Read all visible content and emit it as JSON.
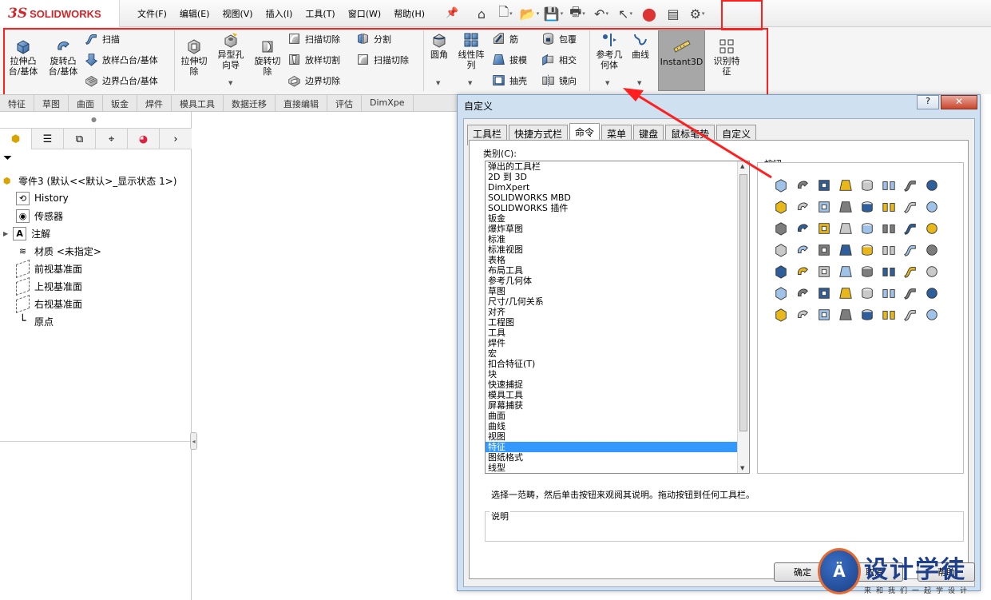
{
  "app": {
    "logo_ds": "3S",
    "logo_name": "SOLIDWORKS"
  },
  "menu": [
    "文件(F)",
    "编辑(E)",
    "视图(V)",
    "插入(I)",
    "工具(T)",
    "窗口(W)",
    "帮助(H)"
  ],
  "quick_tools": [
    "home-icon",
    "new-document-icon",
    "open-icon",
    "save-icon",
    "print-icon",
    "undo-icon",
    "select-icon",
    "rebuild-icon",
    "file-properties-icon",
    "options-gear-icon"
  ],
  "ribbon": {
    "extrude_boss": "拉伸凸\n台/基体",
    "revolve_boss": "旋转凸\n台/基体",
    "sweep": "扫描",
    "loft": "放样凸台/基体",
    "boundary": "边界凸台/基体",
    "extrude_cut": "拉伸切\n除",
    "hole_wizard": "异型孔\n向导",
    "revolve_cut": "旋转切\n除",
    "swept_cut": "扫描切除",
    "lofted_cut": "放样切割",
    "boundary_cut": "边界切除",
    "split": "分割",
    "sweep_cut2": "扫描切除",
    "fillet": "圆角",
    "linear_pattern": "线性阵\n列",
    "rib": "筋",
    "draft": "拔模",
    "shell": "抽壳",
    "wrap": "包覆",
    "intersect": "相交",
    "mirror": "镜向",
    "reference_geometry": "参考几\n何体",
    "curves": "曲线",
    "instant3d": "Instant3D",
    "feature_recognition": "识别特\n征"
  },
  "command_tabs": [
    "特征",
    "草图",
    "曲面",
    "钣金",
    "焊件",
    "模具工具",
    "数据迁移",
    "直接编辑",
    "评估",
    "DimXpe"
  ],
  "feature_manager": {
    "part_name": "零件3 (默认<<默认>_显示状态 1>)",
    "items": [
      {
        "label": "History",
        "icon": "history-icon"
      },
      {
        "label": "传感器",
        "icon": "sensor-icon"
      },
      {
        "label": "注解",
        "icon": "annotation-icon"
      },
      {
        "label": "材质 <未指定>",
        "icon": "material-icon"
      },
      {
        "label": "前视基准面",
        "icon": "plane-icon"
      },
      {
        "label": "上视基准面",
        "icon": "plane-icon"
      },
      {
        "label": "右视基准面",
        "icon": "plane-icon"
      },
      {
        "label": "原点",
        "icon": "origin-icon"
      }
    ]
  },
  "dialog": {
    "title": "自定义",
    "help": "?",
    "close": "✕",
    "tabs": [
      "工具栏",
      "快捷方式栏",
      "命令",
      "菜单",
      "键盘",
      "鼠标笔势",
      "自定义"
    ],
    "active_tab": "命令",
    "category_label": "类别(C):",
    "categories": [
      "弹出的工具栏",
      "2D 到 3D",
      "DimXpert",
      "SOLIDWORKS MBD",
      "SOLIDWORKS 插件",
      "钣金",
      "爆炸草图",
      "标准",
      "标准视图",
      "表格",
      "布局工具",
      "参考几何体",
      "草图",
      "尺寸/几何关系",
      "对齐",
      "工程图",
      "工具",
      "焊件",
      "宏",
      "扣合特征(T)",
      "块",
      "快速捕捉",
      "模具工具",
      "屏幕捕获",
      "曲面",
      "曲线",
      "视图",
      "特征",
      "图纸格式",
      "线型"
    ],
    "selected_category": "特征",
    "buttons_label": "按钮",
    "button_count": 56,
    "hint": "选择一范畴，然后单击按钮来观阅其说明。拖动按钮到任何工具栏。",
    "description_label": "说明",
    "ok": "确定",
    "cancel": "取消",
    "help_button": "帮助"
  },
  "watermark": {
    "mark": "Ä",
    "text": "设计学徒",
    "sub": "来和我们一起学设计"
  },
  "colors": {
    "highlight_red": "#ff1f1f",
    "brand_red": "#d0262a",
    "selection_blue": "#3399ff"
  }
}
